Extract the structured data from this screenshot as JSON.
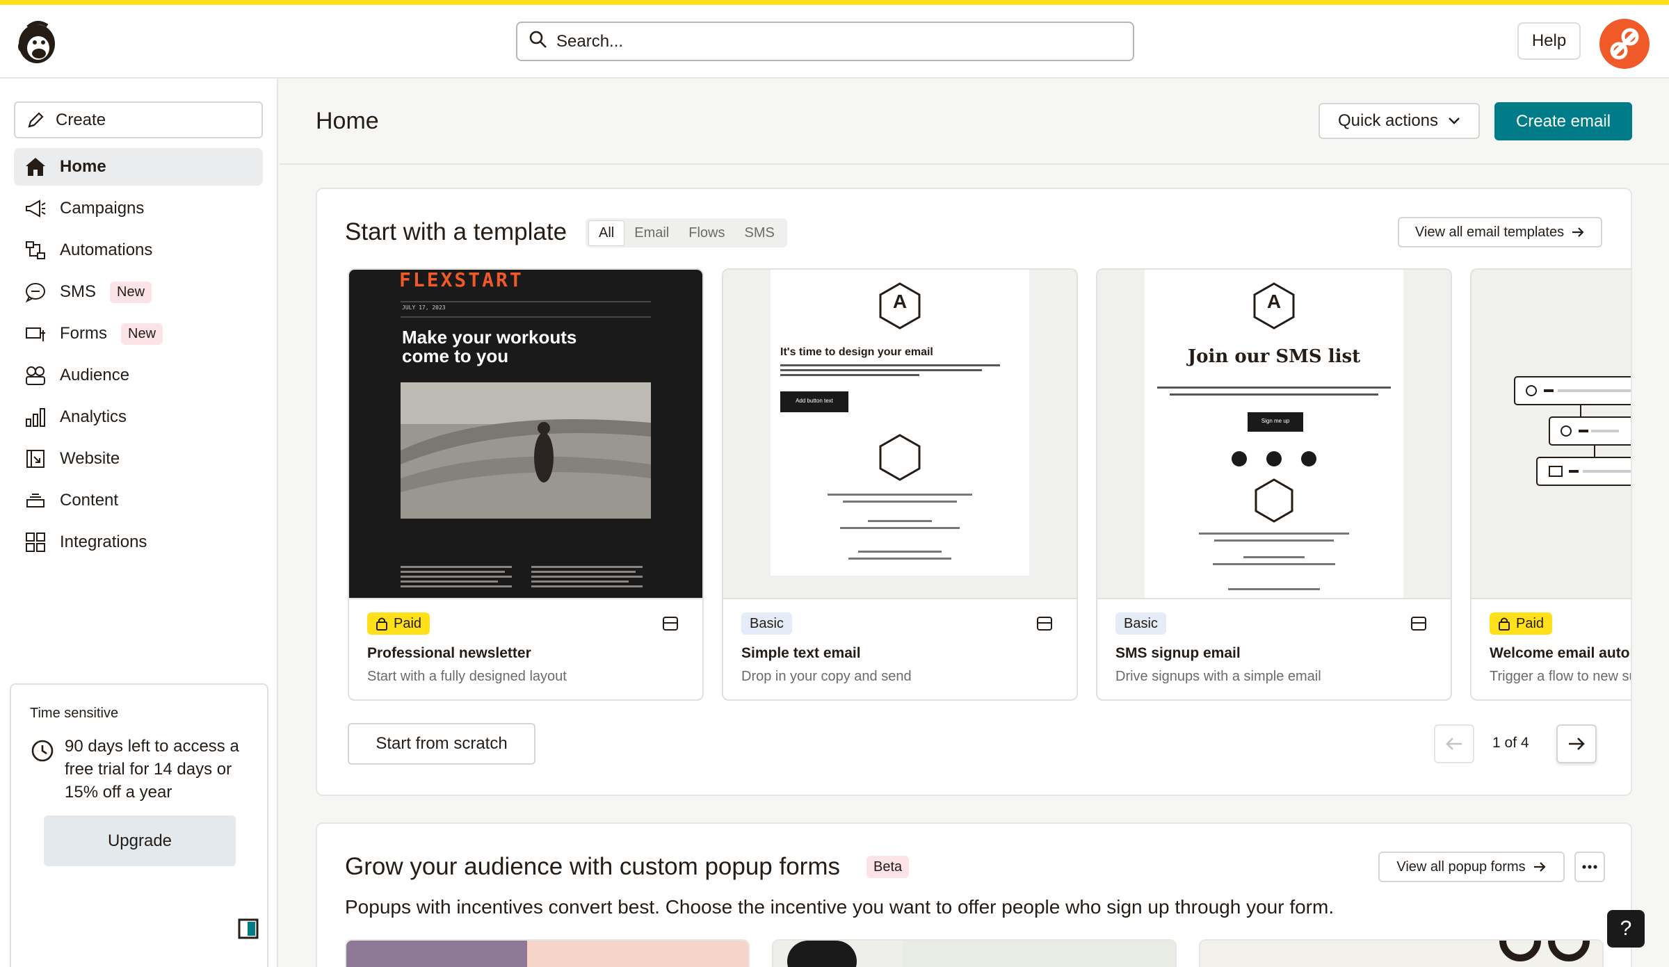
{
  "search": {
    "placeholder": "Search..."
  },
  "topbar": {
    "help_label": "Help"
  },
  "sidebar": {
    "create_label": "Create",
    "items": [
      {
        "label": "Home",
        "icon": "home-icon",
        "active": true
      },
      {
        "label": "Campaigns",
        "icon": "megaphone-icon"
      },
      {
        "label": "Automations",
        "icon": "automation-icon"
      },
      {
        "label": "SMS",
        "icon": "sms-icon",
        "badge": "New"
      },
      {
        "label": "Forms",
        "icon": "form-icon",
        "badge": "New"
      },
      {
        "label": "Audience",
        "icon": "audience-icon"
      },
      {
        "label": "Analytics",
        "icon": "analytics-icon"
      },
      {
        "label": "Website",
        "icon": "website-icon"
      },
      {
        "label": "Content",
        "icon": "content-icon"
      },
      {
        "label": "Integrations",
        "icon": "integrations-icon"
      }
    ],
    "trial": {
      "tag": "Time sensitive",
      "text": "90 days left to access a free trial for 14 days or 15% off a year",
      "button": "Upgrade"
    }
  },
  "header": {
    "title": "Home",
    "quick_actions": "Quick actions",
    "create_email": "Create email"
  },
  "templates": {
    "title": "Start with a template",
    "tabs": [
      "All",
      "Email",
      "Flows",
      "SMS"
    ],
    "view_all": "View all email templates",
    "cards": [
      {
        "tag": "Paid",
        "name": "Professional newsletter",
        "desc": "Start with a fully designed layout"
      },
      {
        "tag": "Basic",
        "name": "Simple text email",
        "desc": "Drop in your copy and send"
      },
      {
        "tag": "Basic",
        "name": "SMS signup email",
        "desc": "Drive signups with a simple email"
      },
      {
        "tag": "Paid",
        "name": "Welcome email automation",
        "desc": "Trigger a flow to new subscribers"
      }
    ],
    "previews": {
      "newsletter": {
        "brand": "FLEXSTART",
        "date": "JULY 17, 2023",
        "headline1": "Make your workouts",
        "headline2": "come to you"
      },
      "simple": {
        "logo": "A",
        "heading": "It's time to design your email",
        "button": "Add button text"
      },
      "sms": {
        "logo": "A",
        "heading": "Join our SMS list",
        "button": "Sign me up"
      }
    },
    "scratch": "Start from scratch",
    "pager": "1 of 4"
  },
  "popups": {
    "title": "Grow your audience with custom popup forms",
    "badge": "Beta",
    "view_all": "View all popup forms",
    "description": "Popups with incentives convert best. Choose the incentive you want to offer people who sign up through your form."
  },
  "help_float": "?",
  "colors": {
    "accent": "#007c89",
    "brand_yellow": "#ffe01b",
    "avatar": "#f05a28"
  }
}
